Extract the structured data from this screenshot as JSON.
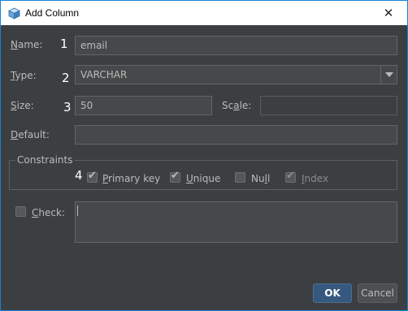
{
  "window": {
    "title": "Add Column",
    "icon": "cube-icon",
    "close_label": "✕"
  },
  "form": {
    "name": {
      "label_u": "N",
      "label_rest": "ame:",
      "value": "email"
    },
    "type": {
      "label_u": "T",
      "label_rest": "ype:",
      "value": "VARCHAR"
    },
    "size": {
      "label_u": "S",
      "label_rest": "ize:",
      "value": "50"
    },
    "scale": {
      "label_pre": "Sc",
      "label_u": "a",
      "label_rest": "le:",
      "value": ""
    },
    "default": {
      "label_u": "D",
      "label_rest": "efault:",
      "value": ""
    }
  },
  "annotations": [
    "1",
    "2",
    "3",
    "4"
  ],
  "constraints": {
    "title": "Constraints",
    "primary_key": {
      "label_u": "P",
      "label_rest": "rimary key",
      "checked": true
    },
    "unique": {
      "label_u": "U",
      "label_rest": "nique",
      "checked": true
    },
    "null": {
      "label_pre": "Nu",
      "label_u": "l",
      "label_rest": "l",
      "checked": false
    },
    "index": {
      "label_u": "I",
      "label_rest": "ndex",
      "checked": true,
      "disabled": true
    }
  },
  "check": {
    "label_u": "C",
    "label_rest": "heck:",
    "checked": false,
    "value": ""
  },
  "buttons": {
    "ok": "OK",
    "cancel": "Cancel"
  },
  "colors": {
    "background": "#3c3f41",
    "accent_border": "#1883d7",
    "ok_button": "#365880",
    "text": "#bbbbbb"
  }
}
